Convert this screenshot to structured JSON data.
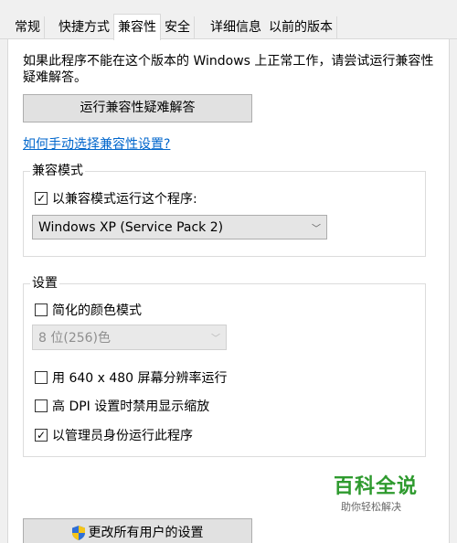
{
  "tabs": [
    {
      "label": "常规",
      "active": false
    },
    {
      "label": "快捷方式",
      "active": false
    },
    {
      "label": "兼容性",
      "active": true
    },
    {
      "label": "安全",
      "active": false
    },
    {
      "label": "详细信息",
      "active": false
    },
    {
      "label": "以前的版本",
      "active": false
    }
  ],
  "intro": {
    "line1": "如果此程序不能在这个版本的 Windows 上正常工作，请尝试运行兼容性",
    "line2": "疑难解答。"
  },
  "troubleshoot_button": "运行兼容性疑难解答",
  "manual_link": "如何手动选择兼容性设置?",
  "compat_mode": {
    "title": "兼容模式",
    "checkbox_label": "以兼容模式运行这个程序:",
    "checked": true,
    "selected_os": "Windows XP (Service Pack 2)"
  },
  "settings": {
    "title": "设置",
    "reduced_color": {
      "label": "简化的颜色模式",
      "checked": false
    },
    "color_select": "8 位(256)色",
    "res_640": {
      "label": "用 640 x 480 屏幕分辨率运行",
      "checked": false
    },
    "high_dpi": {
      "label": "高 DPI 设置时禁用显示缩放",
      "checked": false
    },
    "run_admin": {
      "label": "以管理员身份运行此程序",
      "checked": true
    }
  },
  "watermark": {
    "title": "百科全说",
    "subtitle": "助你轻松解决"
  },
  "all_users_button": "更改所有用户的设置",
  "check_glyph": "✓",
  "colors": {
    "accent_link": "#0066cc",
    "watermark_green": "#2e9a2e",
    "shield_blue": "#2f6fd6",
    "shield_yellow": "#f5c518"
  }
}
